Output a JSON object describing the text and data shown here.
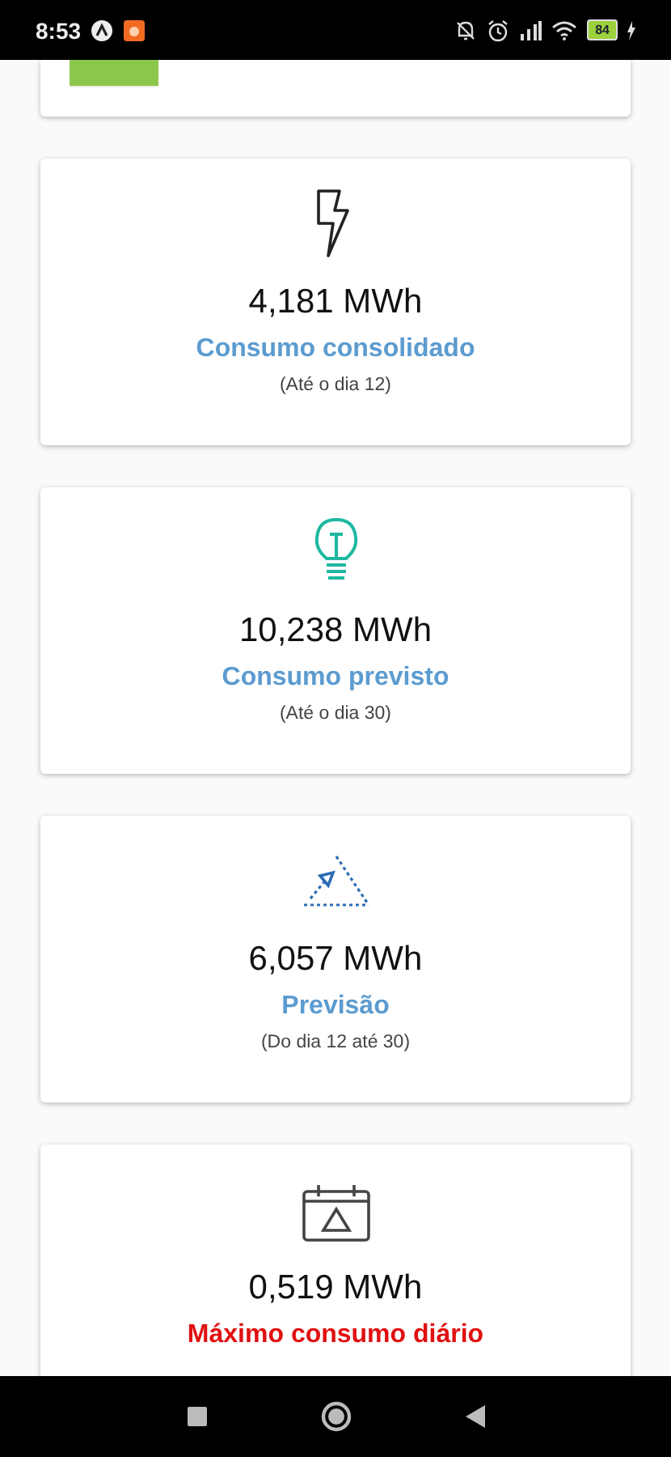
{
  "status_bar": {
    "time": "8:53",
    "battery": "84"
  },
  "cards": [
    {
      "kind": "bolt",
      "value": "4,181 MWh",
      "title": "Consumo consolidado",
      "color": "#5b9bd0",
      "subtitle": "(Até o dia 12)"
    },
    {
      "kind": "bulb",
      "value": "10,238 MWh",
      "title": "Consumo previsto",
      "color": "#5b9bd0",
      "subtitle": "(Até o dia 30)"
    },
    {
      "kind": "forecast",
      "value": "6,057 MWh",
      "title": "Previsão",
      "color": "#5b9bd0",
      "subtitle": "(Do dia 12 até 30)"
    },
    {
      "kind": "calendar",
      "value": "0,519 MWh",
      "title": "Máximo consumo diário",
      "color": "#e01010"
    }
  ]
}
